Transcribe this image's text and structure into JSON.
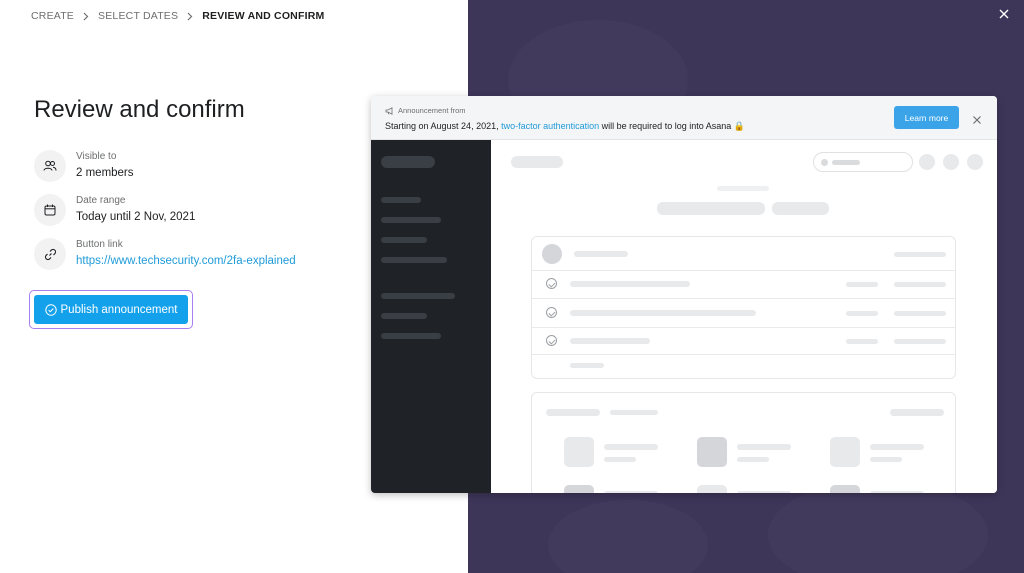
{
  "breadcrumb": {
    "items": [
      "CREATE",
      "SELECT DATES",
      "REVIEW AND CONFIRM"
    ]
  },
  "page_title": "Review and confirm",
  "details": {
    "visible": {
      "label": "Visible to",
      "value": "2 members",
      "icon": "users-icon"
    },
    "date": {
      "label": "Date range",
      "value": "Today until 2 Nov, 2021",
      "icon": "calendar-icon"
    },
    "link": {
      "label": "Button link",
      "value": "https://www.techsecurity.com/2fa-explained",
      "icon": "link-icon"
    }
  },
  "publish_button": {
    "label": "Publish announcement",
    "icon": "check-circle-icon"
  },
  "preview": {
    "banner": {
      "from_label": "Announcement from",
      "message_before": "Starting on August 24, 2021, ",
      "message_link": "two-factor authentication",
      "message_after": " will be required to log into Asana 🔒",
      "button_label": "Learn more"
    }
  },
  "colors": {
    "accent": "#14a1ec",
    "link": "#1f9bd8",
    "focus_ring": "#a97ef0",
    "right_bg": "#3e3659",
    "preview_sidebar": "#1f2328"
  }
}
